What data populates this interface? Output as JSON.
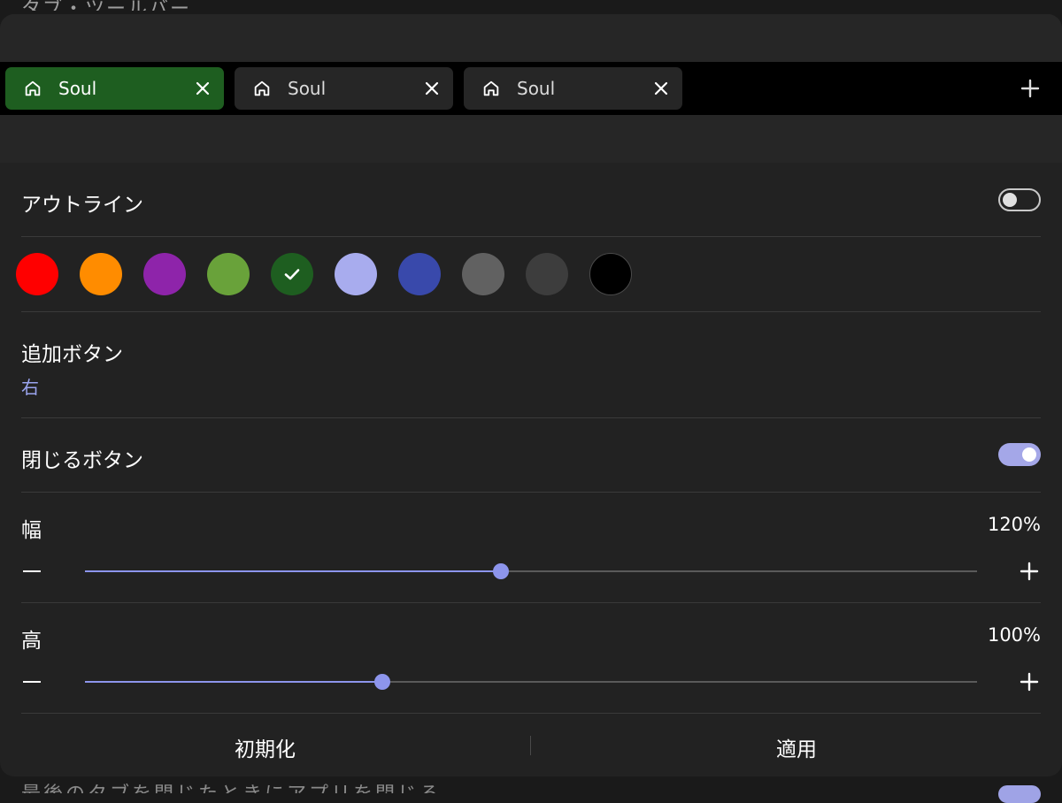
{
  "backdrop": {
    "top_text": "タブ・ツールバー",
    "bottom_text": "最後のタブを閉じたときにアプリを閉じる"
  },
  "preview": {
    "tabs": [
      {
        "label": "Soul",
        "active": true
      },
      {
        "label": "Soul",
        "active": false
      },
      {
        "label": "Soul",
        "active": false
      }
    ]
  },
  "settings": {
    "outline": {
      "label": "アウトライン",
      "enabled": false
    },
    "colors": {
      "swatches": [
        "#ff0000",
        "#ff8c00",
        "#8e24aa",
        "#69a23a",
        "#1e5e20",
        "#a8acee",
        "#3949ab",
        "#616161",
        "#3d3d3d",
        "#000000"
      ],
      "selected": "#1e5e20"
    },
    "add_button": {
      "label": "追加ボタン",
      "value": "右"
    },
    "close_button": {
      "label": "閉じるボタン",
      "enabled": true
    },
    "width": {
      "label": "幅",
      "value": "120%",
      "level": 0.466
    },
    "height": {
      "label": "高",
      "value": "100%",
      "level": 0.333
    }
  },
  "footer": {
    "reset_label": "初期化",
    "apply_label": "適用"
  },
  "colors": {
    "accent": "#8d95ec",
    "active_tab": "#1e5e20",
    "sheet_bg": "#222222"
  }
}
